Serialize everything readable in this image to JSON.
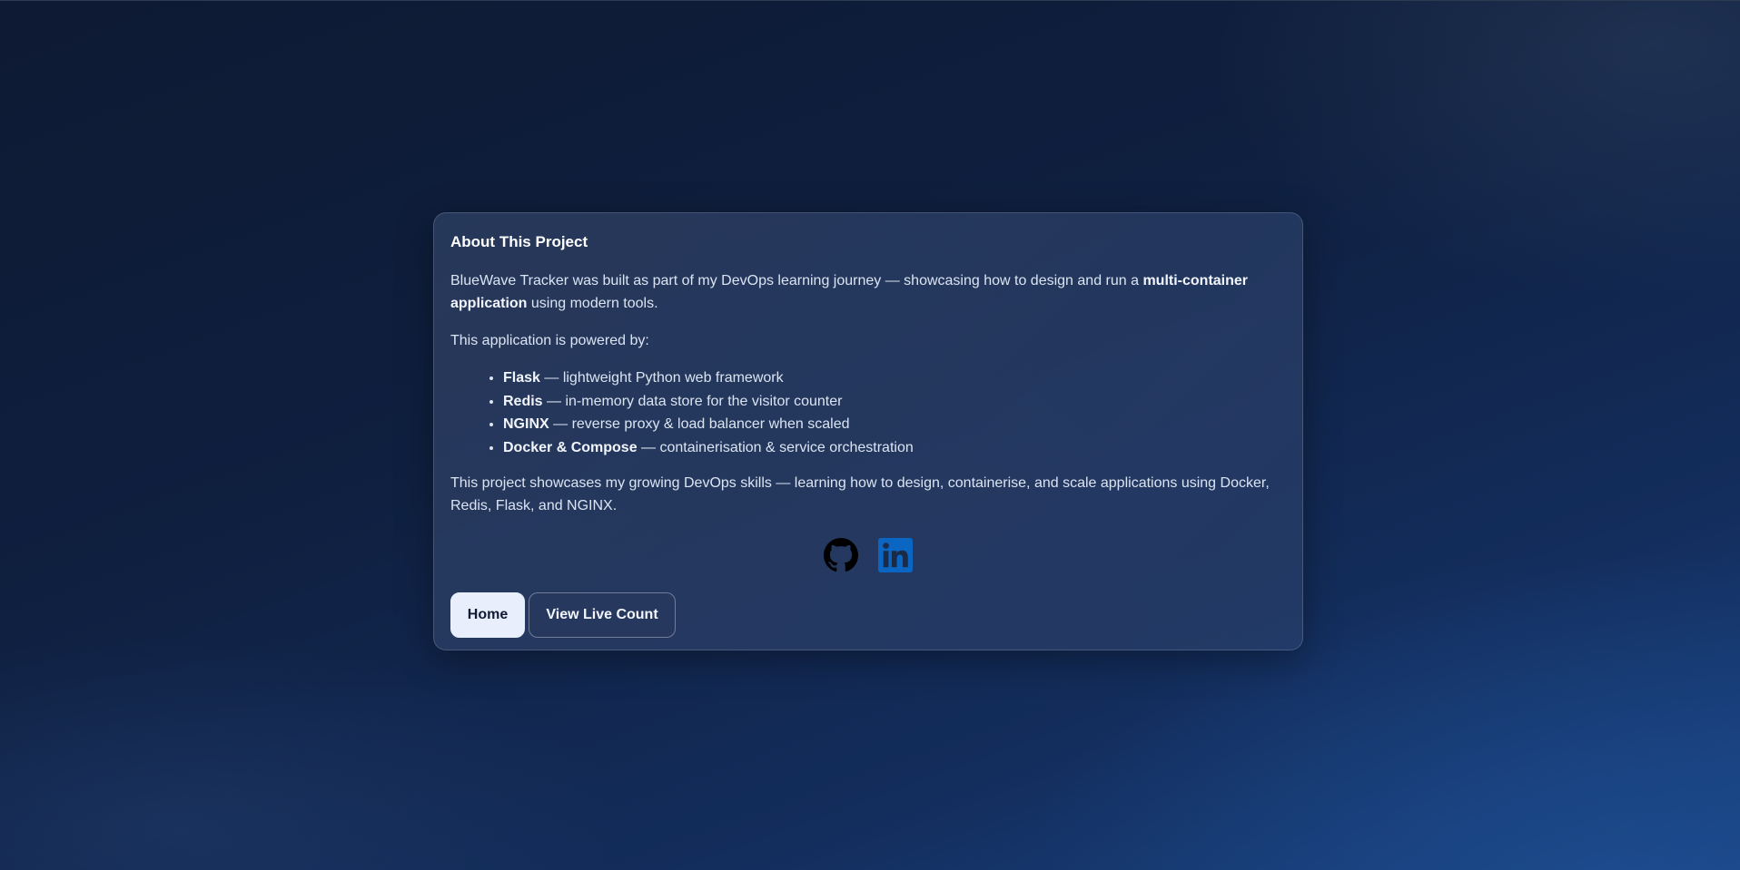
{
  "card": {
    "title": "About This Project",
    "intro": {
      "before": "BlueWave Tracker was built as part of my DevOps learning journey — showcasing how to design and run a ",
      "bold": "multi-container application",
      "after": " using modern tools."
    },
    "powered_by": "This application is powered by:",
    "stack": [
      {
        "name": "Flask",
        "desc": " — lightweight Python web framework"
      },
      {
        "name": "Redis",
        "desc": " — in-memory data store for the visitor counter"
      },
      {
        "name": "NGINX",
        "desc": " — reverse proxy & load balancer when scaled"
      },
      {
        "name": "Docker & Compose",
        "desc": " — containerisation & service orchestration"
      }
    ],
    "closing": "This project showcases my growing DevOps skills — learning how to design, containerise, and scale applications using Docker, Redis, Flask, and NGINX."
  },
  "social": {
    "icons": [
      "github-icon",
      "linkedin-icon"
    ],
    "linkedin_color": "#0a66c2",
    "github_color": "#000000"
  },
  "buttons": {
    "home_label": "Home",
    "live_label": "View Live Count"
  },
  "colors": {
    "background": "#10213f",
    "card_bg": "#2c4068",
    "home_button_bg": "#e8eefb"
  }
}
